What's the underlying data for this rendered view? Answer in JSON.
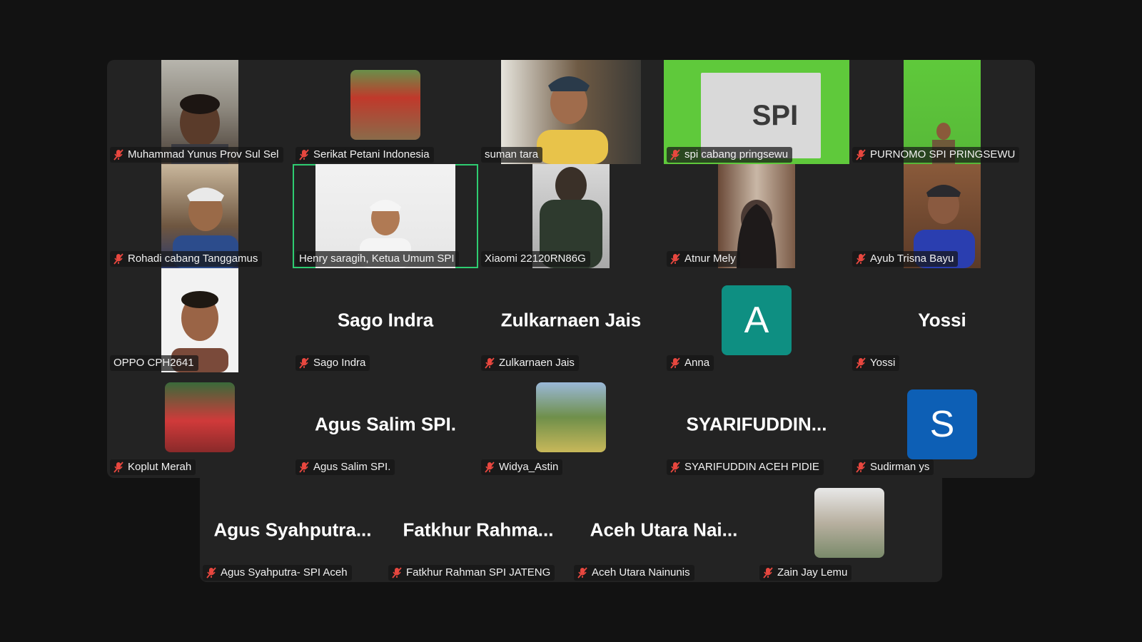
{
  "colors": {
    "background": "#121212",
    "tile": "#232323",
    "active_speaker_border": "#2ecc71",
    "muted_icon": "#e8473f"
  },
  "tiles": [
    {
      "name": "Muhammad Yunus Prov Sul Sel",
      "muted": true,
      "display": "video"
    },
    {
      "name": "Serikat Petani Indonesia",
      "muted": true,
      "display": "photo"
    },
    {
      "name": "suman tara",
      "muted": false,
      "display": "video"
    },
    {
      "name": "spi cabang pringsewu",
      "muted": true,
      "display": "video",
      "banner_text": "SPI"
    },
    {
      "name": "PURNOMO SPI PRINGSEWU",
      "muted": true,
      "display": "video"
    },
    {
      "name": "Rohadi cabang Tanggamus",
      "muted": true,
      "display": "video"
    },
    {
      "name": "Henry saragih, Ketua Umum SPI",
      "muted": false,
      "display": "video",
      "active_speaker": true
    },
    {
      "name": "Xiaomi 22120RN86G",
      "muted": false,
      "display": "video"
    },
    {
      "name": "Atnur Mely",
      "muted": true,
      "display": "video"
    },
    {
      "name": "Ayub Trisna Bayu",
      "muted": true,
      "display": "video"
    },
    {
      "name": "OPPO CPH2641",
      "muted": false,
      "display": "video"
    },
    {
      "name": "Sago Indra",
      "muted": true,
      "display": "name",
      "big_name": "Sago Indra"
    },
    {
      "name": "Zulkarnaen Jais",
      "muted": true,
      "display": "name",
      "big_name": "Zulkarnaen Jais"
    },
    {
      "name": "Anna",
      "muted": true,
      "display": "avatar",
      "avatar_letter": "A",
      "avatar_color": "#0e8f82"
    },
    {
      "name": "Yossi",
      "muted": true,
      "display": "name",
      "big_name": "Yossi"
    },
    {
      "name": "Koplut Merah",
      "muted": true,
      "display": "photo"
    },
    {
      "name": "Agus Salim SPI.",
      "muted": true,
      "display": "name",
      "big_name": "Agus Salim SPI."
    },
    {
      "name": "Widya_Astin",
      "muted": true,
      "display": "photo"
    },
    {
      "name": "SYARIFUDDIN ACEH PIDIE",
      "muted": true,
      "display": "name",
      "big_name": "SYARIFUDDIN..."
    },
    {
      "name": "Sudirman ys",
      "muted": true,
      "display": "avatar",
      "avatar_letter": "S",
      "avatar_color": "#0d5fb5"
    },
    {
      "name": "Agus Syahputra- SPI Aceh",
      "muted": true,
      "display": "name",
      "big_name": "Agus  Syahputra..."
    },
    {
      "name": "Fatkhur Rahman SPI JATENG",
      "muted": true,
      "display": "name",
      "big_name": "Fatkhur  Rahma..."
    },
    {
      "name": "Aceh Utara Nainunis",
      "muted": true,
      "display": "name",
      "big_name": "Aceh  Utara  Nai..."
    },
    {
      "name": "Zain Jay Lemu",
      "muted": true,
      "display": "photo"
    }
  ]
}
